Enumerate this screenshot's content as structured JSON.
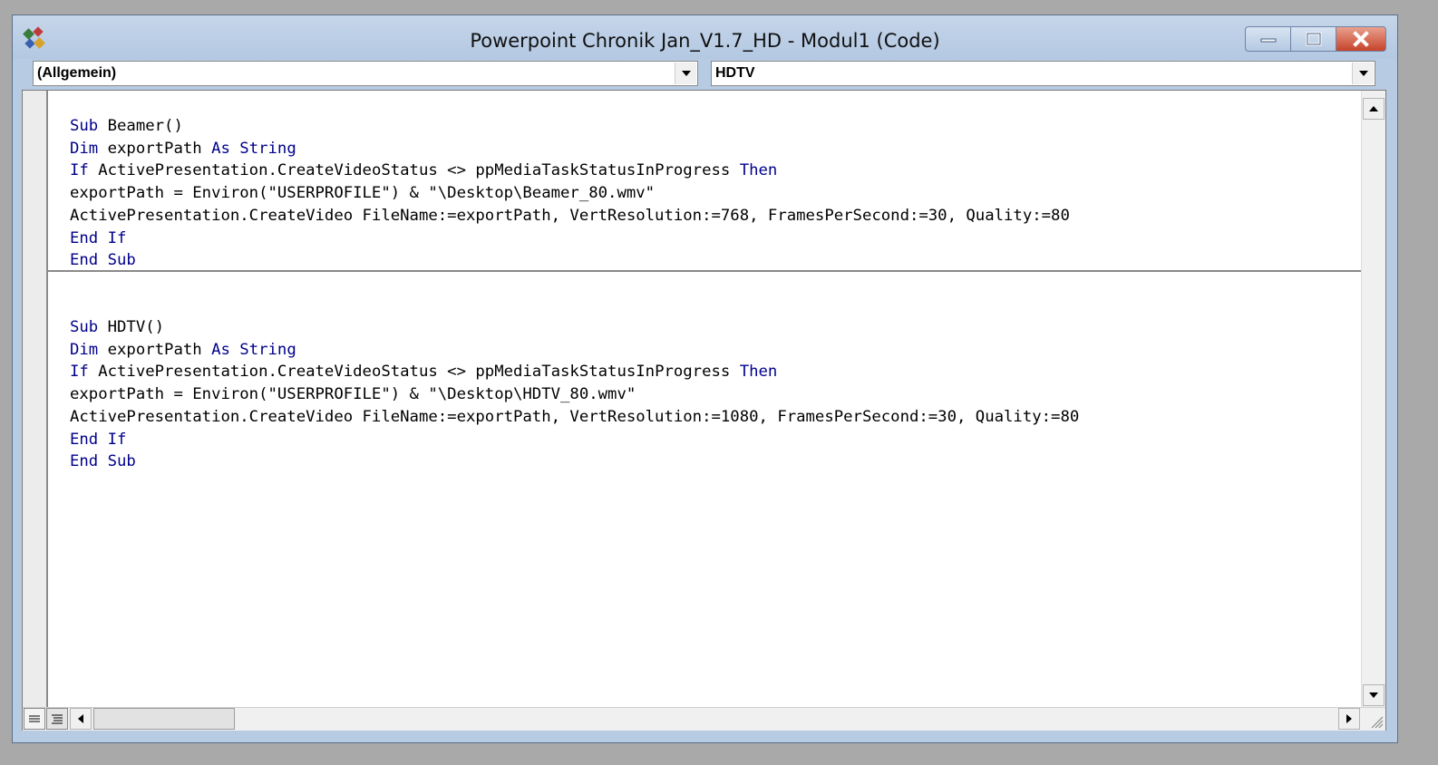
{
  "window": {
    "title": "Powerpoint Chronik Jan_V1.7_HD - Modul1 (Code)",
    "app_icon": "vba-editor-icon",
    "controls": [
      "minimize-icon",
      "maximize-icon",
      "close-icon"
    ]
  },
  "object_combo": {
    "selected": "(Allgemein)"
  },
  "procedure_combo": {
    "selected": "HDTV"
  },
  "code": {
    "procedures": [
      {
        "lines": [
          [
            {
              "t": "Sub",
              "k": true
            },
            {
              "t": " Beamer()",
              "k": false
            }
          ],
          [
            {
              "t": "Dim",
              "k": true
            },
            {
              "t": " exportPath ",
              "k": false
            },
            {
              "t": "As",
              "k": true
            },
            {
              "t": " ",
              "k": false
            },
            {
              "t": "String",
              "k": true
            }
          ],
          [
            {
              "t": "If",
              "k": true
            },
            {
              "t": " ActivePresentation.CreateVideoStatus <> ppMediaTaskStatusInProgress ",
              "k": false
            },
            {
              "t": "Then",
              "k": true
            }
          ],
          [
            {
              "t": "exportPath = Environ(\"USERPROFILE\") & \"\\Desktop\\Beamer_80.wmv\"",
              "k": false
            }
          ],
          [
            {
              "t": "ActivePresentation.CreateVideo FileName:=exportPath, VertResolution:=768, FramesPerSecond:=30, Quality:=80",
              "k": false
            }
          ],
          [
            {
              "t": "End",
              "k": true
            },
            {
              "t": " ",
              "k": false
            },
            {
              "t": "If",
              "k": true
            }
          ],
          [
            {
              "t": "End",
              "k": true
            },
            {
              "t": " ",
              "k": false
            },
            {
              "t": "Sub",
              "k": true
            }
          ]
        ]
      },
      {
        "lines": [
          [
            {
              "t": "Sub",
              "k": true
            },
            {
              "t": " HDTV()",
              "k": false
            }
          ],
          [
            {
              "t": "Dim",
              "k": true
            },
            {
              "t": " exportPath ",
              "k": false
            },
            {
              "t": "As",
              "k": true
            },
            {
              "t": " ",
              "k": false
            },
            {
              "t": "String",
              "k": true
            }
          ],
          [
            {
              "t": "If",
              "k": true
            },
            {
              "t": " ActivePresentation.CreateVideoStatus <> ppMediaTaskStatusInProgress ",
              "k": false
            },
            {
              "t": "Then",
              "k": true
            }
          ],
          [
            {
              "t": "exportPath = Environ(\"USERPROFILE\") & \"\\Desktop\\HDTV_80.wmv\"",
              "k": false
            }
          ],
          [
            {
              "t": "ActivePresentation.CreateVideo FileName:=exportPath, VertResolution:=1080, FramesPerSecond:=30, Quality:=80",
              "k": false
            }
          ],
          [
            {
              "t": "End",
              "k": true
            },
            {
              "t": " ",
              "k": false
            },
            {
              "t": "If",
              "k": true
            }
          ],
          [
            {
              "t": "End",
              "k": true
            },
            {
              "t": " ",
              "k": false
            },
            {
              "t": "Sub",
              "k": true
            }
          ]
        ]
      }
    ]
  },
  "colors": {
    "keyword": "#00008b",
    "text": "#000000",
    "titlebar": "#b7cbe3"
  }
}
